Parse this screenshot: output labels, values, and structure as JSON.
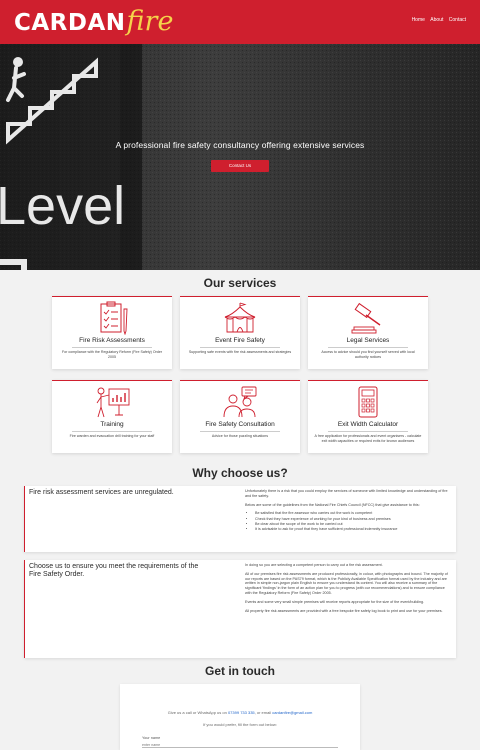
{
  "header": {
    "logo_main": "CARDAN",
    "logo_fire": "fire",
    "nav": [
      "Home",
      "About",
      "Contact"
    ]
  },
  "hero": {
    "sign_text": "Level",
    "title": "A professional fire safety consultancy offering extensive services",
    "button": "Contact Us"
  },
  "services": {
    "title": "Our services",
    "cards": [
      {
        "icon": "clipboard-checklist-icon",
        "title": "Fire Risk Assessments",
        "desc": "For compliance with the Regulatory Reform (Fire Safety) Order 2005"
      },
      {
        "icon": "circus-tent-icon",
        "title": "Event Fire Safety",
        "desc": "Supporting safe events with fire risk assessments and strategies"
      },
      {
        "icon": "gavel-icon",
        "title": "Legal Services",
        "desc": "Access to advice should you find yourself served with local authority notices"
      },
      {
        "icon": "presenter-chart-icon",
        "title": "Training",
        "desc": "Fire warden and evacuation drill training for your staff"
      },
      {
        "icon": "consultation-people-icon",
        "title": "Fire Safety Consultation",
        "desc": "Advice for those puzzling situations"
      },
      {
        "icon": "calculator-icon",
        "title": "Exit Width Calculator",
        "desc": "A free application for professionals and event organisers - calculate exit width capacities or required exits for known audiences"
      }
    ]
  },
  "why": {
    "title": "Why choose us?",
    "block1": {
      "heading": "Fire risk assessment services are unregulated.",
      "p1": "Unfortunately there is a risk that you could employ the services of someone with limited knowledge and understanding of fire and fire safety.",
      "p2": "Below are some of the guidelines from the National Fire Chiefs Council (NFCC) that give assistance to this:",
      "bullets": [
        "Be satisfied that the fire assessor who carries out the work is competent",
        "Check that they have experience of working for your kind of business and premises",
        "Be clear about the scope of the work to be carried out",
        "It is advisable to ask for proof that they have sufficient professional indemnity insurance"
      ]
    },
    "block2": {
      "heading": "Choose us to ensure you meet the requirements of the Fire Safety Order.",
      "p1": "In doing so you are selecting a competent person to carry out a fire risk assessment.",
      "p2": "All of our premises fire risk assessments are produced professionally, in colour, with photographs and bound. The majority of our reports are based on the PAS79 format, which is the Publicly Available Specification format used by the industry and are written in simple non-jargon plain English to ensure you understand its content. You will also receive a summary of the significant 'findings' in the form of an action plan for you to progress (with our recommendations) and to ensure compliance with the Regulatory Reform (Fire Safety) Order 2005.",
      "p3": "Events and some very small simple premises will receive reports appropriate for the size of the event/building.",
      "p4": "All property fire risk assessments are provided with a free bespoke fire safety log book to print and use for your premises."
    }
  },
  "contact": {
    "title": "Get in touch",
    "line1_pre": "Give us a call or WhatsApp us on",
    "phone": "07399 733 335",
    "line1_mid": ", or email",
    "email": "cardanfire@gmail.com",
    "line2": "If you would prefer, fill the form out below:",
    "name_label": "Your name",
    "name_placeholder": "enter name"
  },
  "colors": {
    "brand_red": "#cf1f2e",
    "logo_yellow": "#f5d34a",
    "link_blue": "#1e63c9"
  }
}
